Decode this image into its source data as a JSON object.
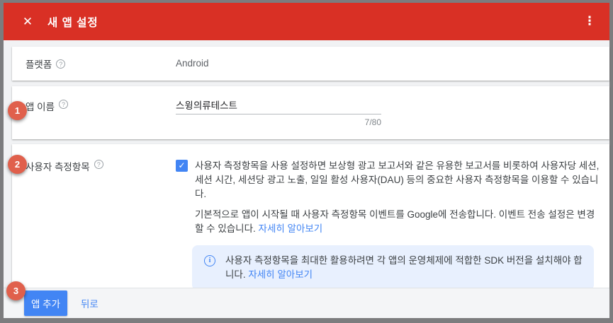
{
  "header": {
    "title": "새 앱 설정"
  },
  "icons": {
    "close": "✕",
    "menu": "⋮",
    "help": "?",
    "check": "✓",
    "info": "i"
  },
  "badges": {
    "step1": "1",
    "step2": "2",
    "step3": "3"
  },
  "form": {
    "platform": {
      "label": "플랫폼",
      "value": "Android"
    },
    "app_name": {
      "label": "앱 이름",
      "value": "스윙의류테스트",
      "counter": "7/80"
    },
    "user_metrics": {
      "label": "사용자 측정항목",
      "checkbox_checked": true,
      "description": "사용자 측정항목을 사용 설정하면 보상형 광고 보고서와 같은 유용한 보고서를 비롯하여 사용자당 세션, 세션 시간, 세션당 광고 노출, 일일 활성 사용자(DAU) 등의 중요한 사용자 측정항목을 이용할 수 있습니다.",
      "note": "기본적으로 앱이 시작될 때 사용자 측정항목 이벤트를 Google에 전송합니다. 이벤트 전송 설정은 변경할 수 있습니다. ",
      "note_link": "자세히 알아보기",
      "info": "사용자 측정항목을 최대한 활용하려면 각 앱의 운영체제에 적합한 SDK 버전을 설치해야 합니다. ",
      "info_link": "자세히 알아보기"
    }
  },
  "footer": {
    "add_app_label": "앱 추가",
    "back_label": "뒤로"
  },
  "colors": {
    "header_red": "#d93025",
    "badge_orange": "#e0604c",
    "accent_blue": "#4285f4",
    "info_box_bg": "#e8f0fe",
    "frame_border": "#7c7c7e"
  }
}
